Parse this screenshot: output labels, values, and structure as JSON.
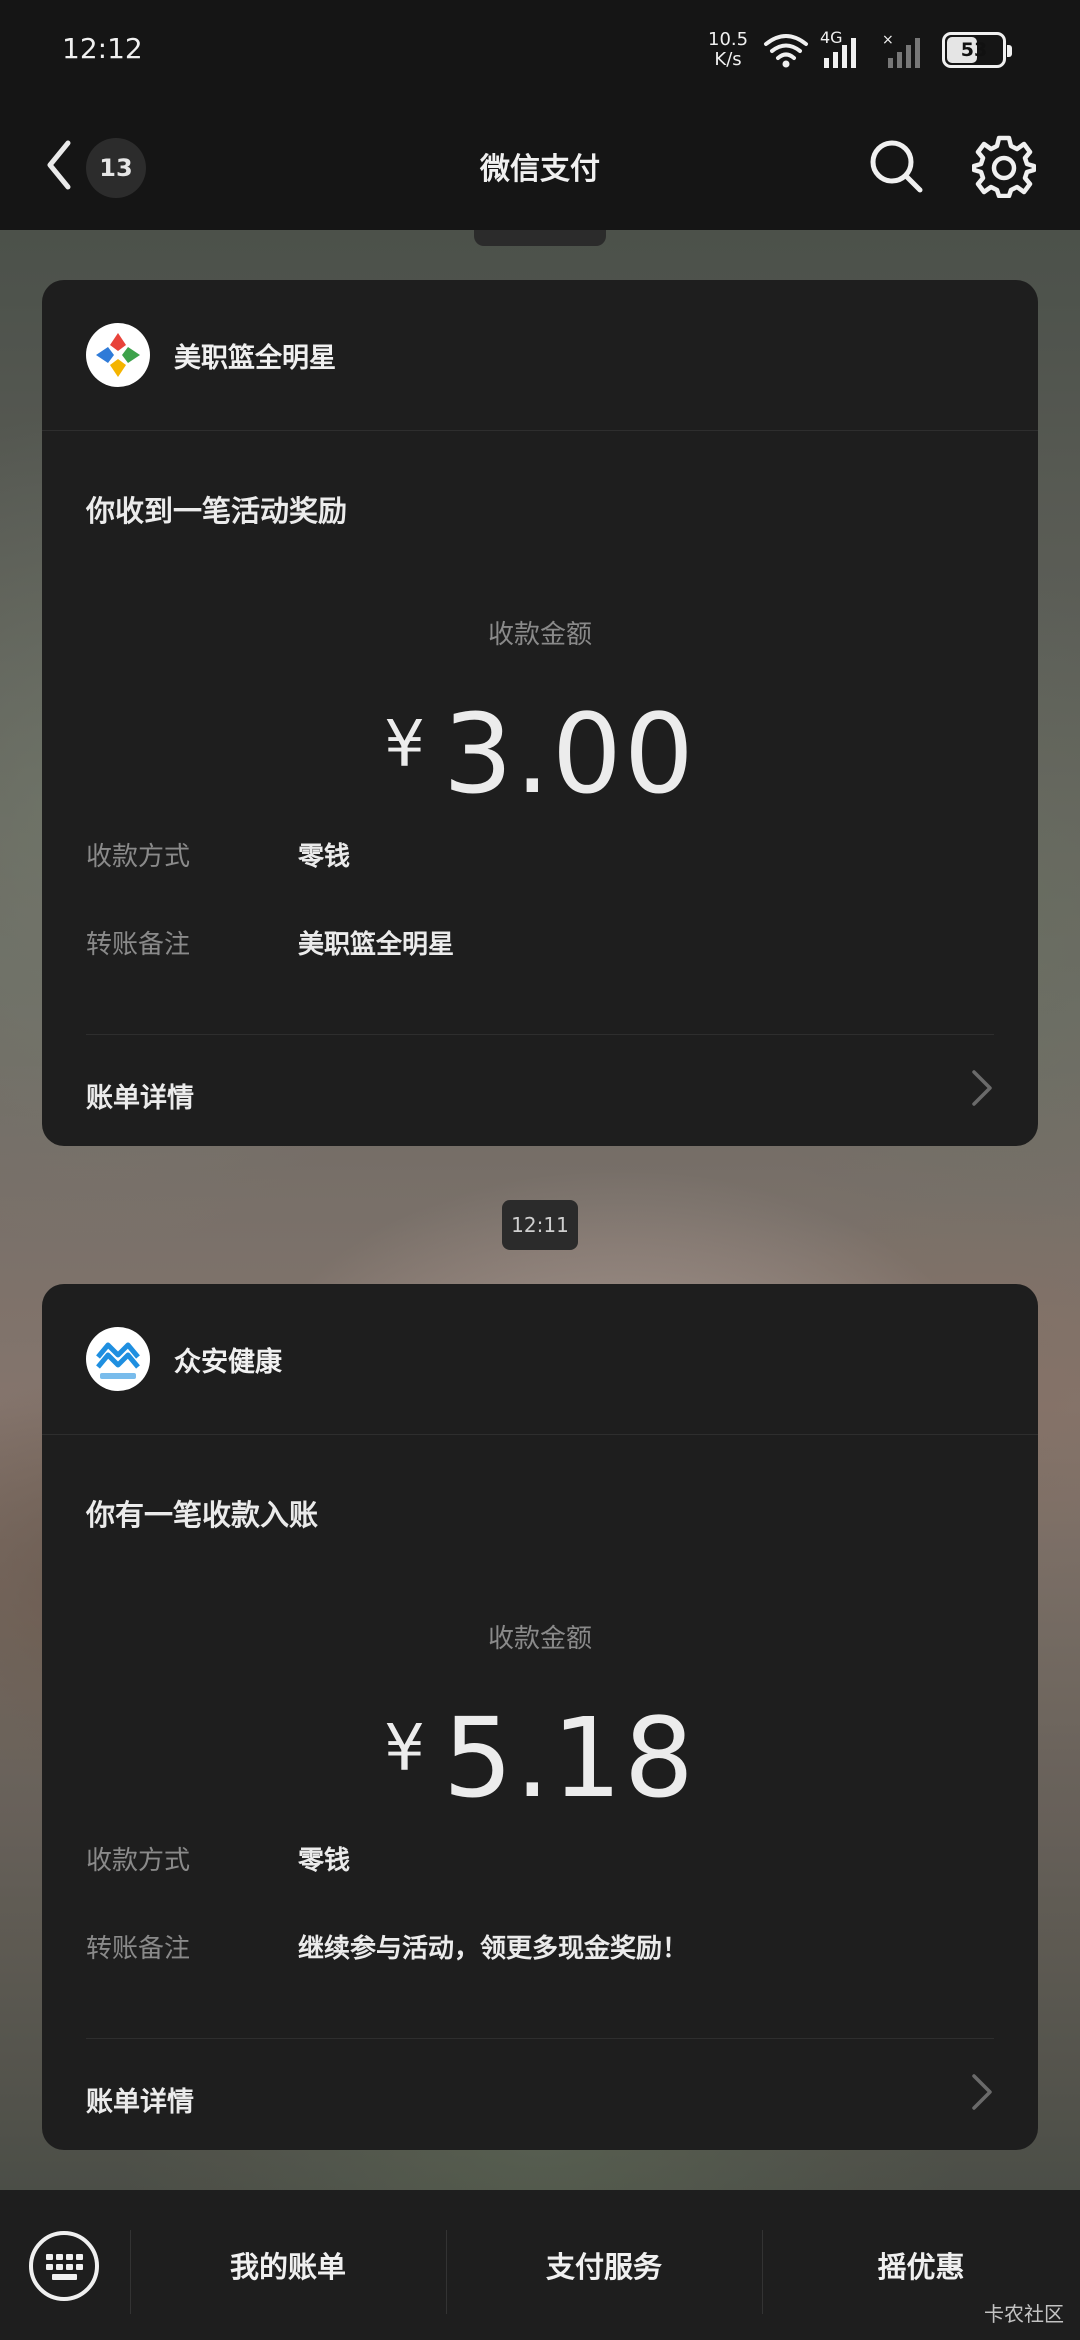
{
  "status_bar": {
    "time": "12:12",
    "net_speed_value": "10.5",
    "net_speed_unit": "K/s",
    "network_type": "4G",
    "battery": "53"
  },
  "header": {
    "unread_count": "13",
    "title": "微信支付"
  },
  "messages": [
    {
      "merchant": "美职篮全明星",
      "notice": "你收到一笔活动奖励",
      "amount_label": "收款金额",
      "currency": "¥",
      "amount": "3.00",
      "method_label": "收款方式",
      "method_value": "零钱",
      "remark_label": "转账备注",
      "remark_value": "美职篮全明星",
      "detail_label": "账单详情"
    },
    {
      "timestamp": "12:11",
      "merchant": "众安健康",
      "notice": "你有一笔收款入账",
      "amount_label": "收款金额",
      "currency": "¥",
      "amount": "5.18",
      "method_label": "收款方式",
      "method_value": "零钱",
      "remark_label": "转账备注",
      "remark_value": "继续参与活动，领更多现金奖励！",
      "detail_label": "账单详情"
    }
  ],
  "bottom_bar": {
    "tabs": [
      "我的账单",
      "支付服务",
      "摇优惠"
    ]
  },
  "watermark": "卡农社区",
  "icons": {
    "back": "chevron-left-icon",
    "search": "search-icon",
    "settings": "gear-icon",
    "keyboard": "keyboard-icon",
    "detail": "chevron-right-icon"
  }
}
